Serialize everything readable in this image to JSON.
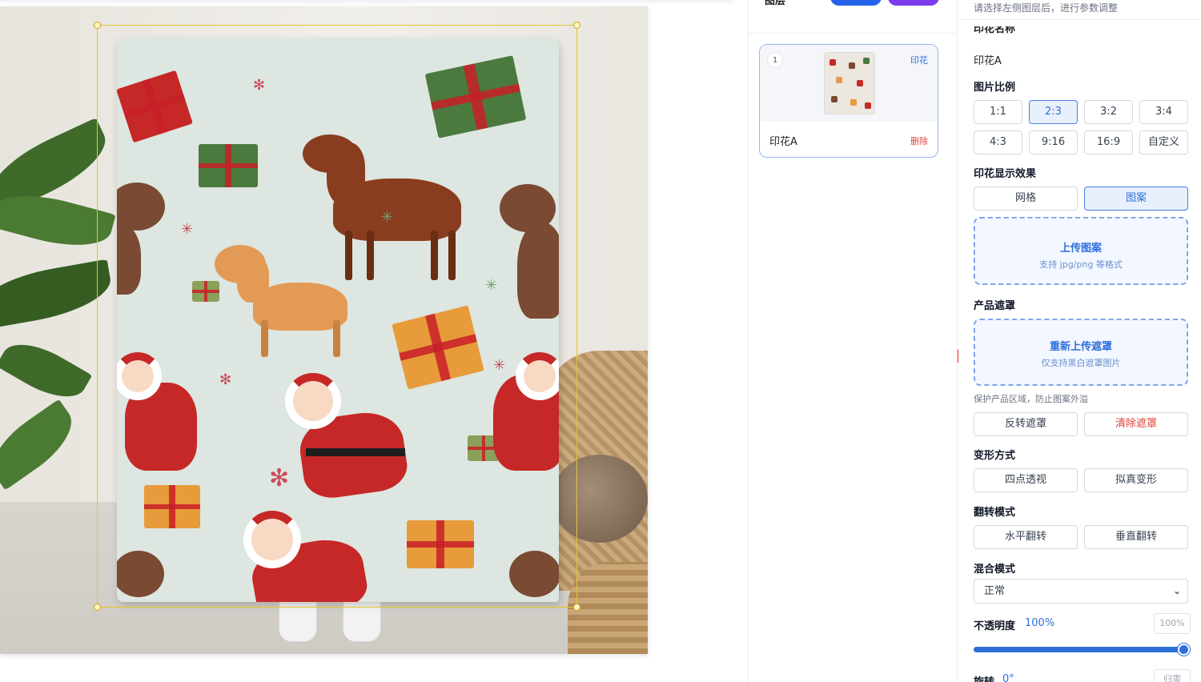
{
  "layers_panel": {
    "title": "图层",
    "card": {
      "index": "1",
      "type_tag": "印花",
      "name": "印花A",
      "delete_label": "删除"
    }
  },
  "settings": {
    "hint": "请选择左侧图层后，进行参数调整",
    "print_name_label": "印花名称",
    "print_name_value": "印花A",
    "ratio": {
      "title": "图片比例",
      "options": [
        "1:1",
        "2:3",
        "3:2",
        "3:4",
        "4:3",
        "9:16",
        "16:9",
        "自定义"
      ],
      "selected": "2:3"
    },
    "display_effect": {
      "title": "印花显示效果",
      "options": [
        "网格",
        "图案"
      ],
      "selected": "图案",
      "upload_title": "上传图案",
      "upload_sub": "支持 jpg/png 等格式"
    },
    "mask": {
      "title": "产品遮罩",
      "upload_title": "重新上传遮罩",
      "upload_sub": "仅支持黑白遮罩图片",
      "note": "保护产品区域，防止图案外溢",
      "invert_label": "反转遮罩",
      "clear_label": "清除遮罩"
    },
    "transform": {
      "title": "变形方式",
      "options": [
        "四点透视",
        "拟真变形"
      ]
    },
    "flip": {
      "title": "翻转模式",
      "options": [
        "水平翻转",
        "垂直翻转"
      ]
    },
    "blend": {
      "title": "混合模式",
      "value": "正常",
      "caret": "⌄"
    },
    "opacity": {
      "label": "不透明度",
      "value": "100%",
      "input_value": "100%",
      "level": 1.0
    },
    "rotation": {
      "label": "旋转",
      "value": "0°",
      "reset_label": "归零"
    }
  },
  "colors": {
    "accent": "#2f6fdb",
    "danger": "#e0453a",
    "selection": "#e3c62f",
    "arrow": "#e53935"
  }
}
